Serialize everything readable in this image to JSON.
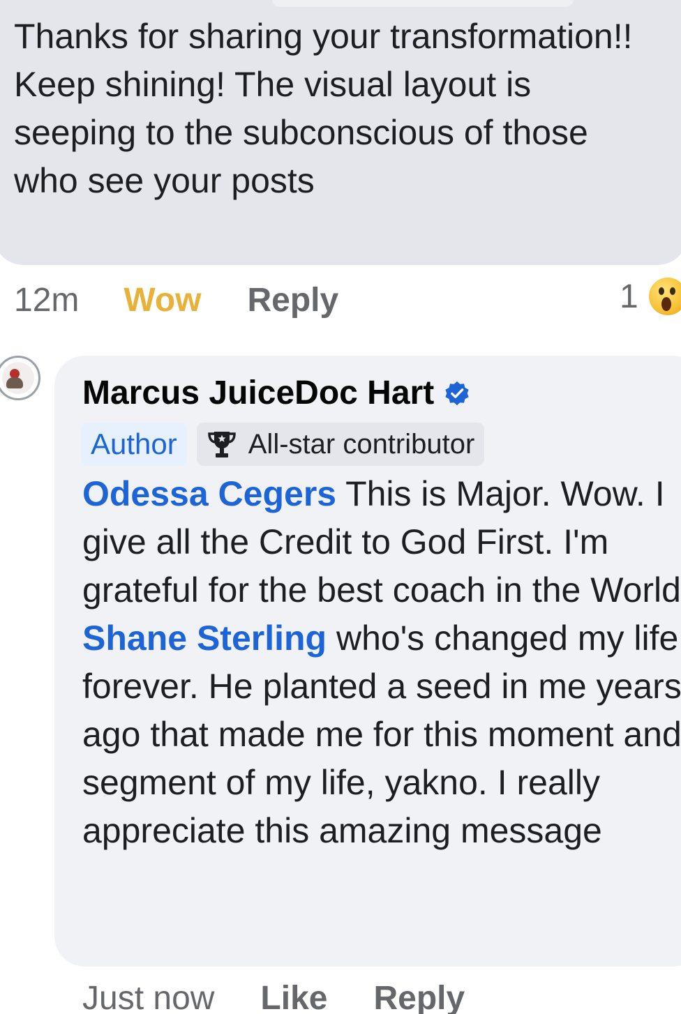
{
  "top_comment": {
    "text": "Thanks for sharing your transformation!! Keep shining! The visual layout is seeping to the subconscious of those who see your posts",
    "time": "12m",
    "reaction_label": "Wow",
    "reply_label": "Reply",
    "reaction_count": "1",
    "reaction_icon": "wow-emoji-icon"
  },
  "reply_comment": {
    "author": "Marcus JuiceDoc Hart",
    "verified_icon": "verified-badge-icon",
    "badges": {
      "author": "Author",
      "allstar": "All-star contributor",
      "allstar_icon": "trophy-icon"
    },
    "mention_1": "Odessa Cegers",
    "text_1": " This is Major. Wow. I give all the Credit to God First. I'm grateful for the best coach in the World ",
    "mention_2": "Shane Sterling",
    "text_2": " who's changed my life forever. He planted a seed in me years ago that made me for this moment and segment of my life, yakno. I really appreciate this amazing message",
    "time": "Just now",
    "like_label": "Like",
    "reply_label": "Reply"
  },
  "colors": {
    "link_blue": "#1d65d6",
    "wow_yellow": "#e8b23a",
    "bubble_grey": "#e4e6eb",
    "bubble_light": "#f0f2f5",
    "meta_grey": "#65676b"
  }
}
